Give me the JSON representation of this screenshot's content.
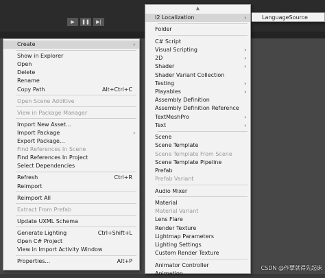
{
  "playbar": {
    "play": "▶",
    "pause": "❚❚",
    "step": "▶|"
  },
  "context_menu": {
    "items": [
      {
        "label": "Create",
        "submenu": true,
        "highlight": true
      },
      {
        "sep": true
      },
      {
        "label": "Show in Explorer"
      },
      {
        "label": "Open"
      },
      {
        "label": "Delete"
      },
      {
        "label": "Rename"
      },
      {
        "label": "Copy Path",
        "shortcut": "Alt+Ctrl+C"
      },
      {
        "sep": true
      },
      {
        "label": "Open Scene Additive",
        "disabled": true
      },
      {
        "sep": true
      },
      {
        "label": "View in Package Manager",
        "disabled": true
      },
      {
        "sep": true
      },
      {
        "label": "Import New Asset..."
      },
      {
        "label": "Import Package",
        "submenu": true
      },
      {
        "label": "Export Package..."
      },
      {
        "label": "Find References In Scene",
        "disabled": true
      },
      {
        "label": "Find References In Project"
      },
      {
        "label": "Select Dependencies"
      },
      {
        "sep": true
      },
      {
        "label": "Refresh",
        "shortcut": "Ctrl+R"
      },
      {
        "label": "Reimport"
      },
      {
        "sep": true
      },
      {
        "label": "Reimport All"
      },
      {
        "sep": true
      },
      {
        "label": "Extract From Prefab",
        "disabled": true
      },
      {
        "sep": true
      },
      {
        "label": "Update UXML Schema"
      },
      {
        "sep": true
      },
      {
        "label": "Generate Lighting",
        "shortcut": "Ctrl+Shift+L"
      },
      {
        "label": "Open C# Project"
      },
      {
        "label": "View in Import Activity Window"
      },
      {
        "sep": true
      },
      {
        "label": "Properties...",
        "shortcut": "Alt+P"
      }
    ]
  },
  "create_submenu": {
    "scroll_up": "▲",
    "items": [
      {
        "label": "I2 Localization",
        "submenu": true,
        "highlight": true
      },
      {
        "sep": true
      },
      {
        "label": "Folder"
      },
      {
        "sep": true
      },
      {
        "label": "C# Script"
      },
      {
        "label": "Visual Scripting",
        "submenu": true
      },
      {
        "label": "2D",
        "submenu": true
      },
      {
        "label": "Shader",
        "submenu": true
      },
      {
        "label": "Shader Variant Collection"
      },
      {
        "label": "Testing",
        "submenu": true
      },
      {
        "label": "Playables",
        "submenu": true
      },
      {
        "label": "Assembly Definition"
      },
      {
        "label": "Assembly Definition Reference"
      },
      {
        "label": "TextMeshPro",
        "submenu": true
      },
      {
        "label": "Text",
        "submenu": true
      },
      {
        "sep": true
      },
      {
        "label": "Scene"
      },
      {
        "label": "Scene Template"
      },
      {
        "label": "Scene Template From Scene",
        "disabled": true
      },
      {
        "label": "Scene Template Pipeline"
      },
      {
        "label": "Prefab"
      },
      {
        "label": "Prefab Variant",
        "disabled": true
      },
      {
        "sep": true
      },
      {
        "label": "Audio Mixer"
      },
      {
        "sep": true
      },
      {
        "label": "Material"
      },
      {
        "label": "Material Variant",
        "disabled": true
      },
      {
        "label": "Lens Flare"
      },
      {
        "label": "Render Texture"
      },
      {
        "label": "Lightmap Parameters"
      },
      {
        "label": "Lighting Settings"
      },
      {
        "label": "Custom Render Texture"
      },
      {
        "sep": true
      },
      {
        "label": "Animator Controller"
      },
      {
        "label": "Animation"
      }
    ]
  },
  "i2_submenu": {
    "items": [
      {
        "label": "LanguageSource"
      }
    ]
  },
  "watermark": "CSDN @作孽就得先起床"
}
